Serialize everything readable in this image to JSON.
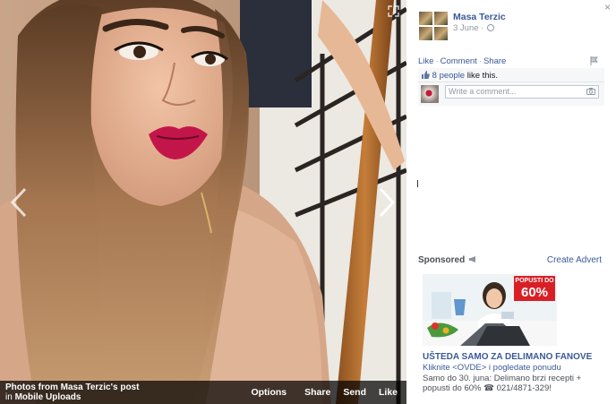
{
  "photo_viewer": {
    "source_line1": "Photos from Masa Terzic's post",
    "source_prefix": "in",
    "source_album": "Mobile Uploads",
    "actions": {
      "options": "Options",
      "share": "Share",
      "send": "Send",
      "like": "Like"
    }
  },
  "post": {
    "author": "Masa Terzic",
    "date": "3 June",
    "date_separator": "·",
    "close_glyph": "×",
    "actions": {
      "like": "Like",
      "comment": "Comment",
      "share": "Share",
      "separator": "·"
    },
    "likes_count": "8 people",
    "likes_suffix": " like this.",
    "comment_placeholder": "Write a comment..."
  },
  "sidebar_ad": {
    "sponsored_label": "Sponsored",
    "create_advert": "Create Advert",
    "badge_line1": "POPUSTI DO",
    "badge_line2": "60%",
    "title": "UŠTEDA SAMO ZA DELIMANO FANOVE",
    "link_text": "Kliknite <OVDE> i pogledate ponudu",
    "description": "Samo do 30. juna: Delimano brzi recepti + popusti do 60% ☎ 021/4871-329!"
  },
  "colors": {
    "link_blue": "#3b5998",
    "badge_red": "#d91f26",
    "photo_bar": "#000000"
  },
  "icons": [
    "chevron-left-icon",
    "chevron-right-icon",
    "expand-icon",
    "close-icon",
    "globe-icon",
    "flag-icon",
    "thumbs-up-icon",
    "camera-icon",
    "megaphone-icon"
  ]
}
